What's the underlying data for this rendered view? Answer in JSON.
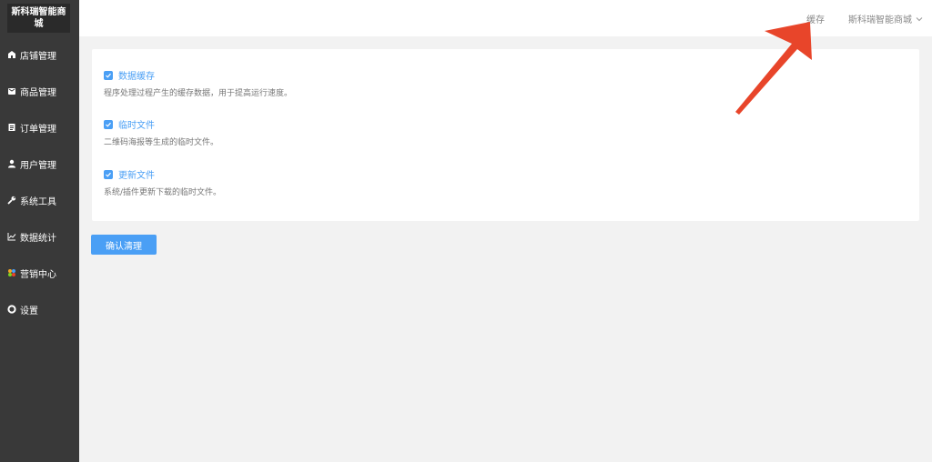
{
  "sidebar": {
    "logo": "斯科瑞智能商城",
    "items": [
      {
        "label": "店铺管理",
        "icon": "store-icon"
      },
      {
        "label": "商品管理",
        "icon": "product-icon"
      },
      {
        "label": "订单管理",
        "icon": "order-icon"
      },
      {
        "label": "用户管理",
        "icon": "user-icon"
      },
      {
        "label": "系统工具",
        "icon": "wrench-icon"
      },
      {
        "label": "数据统计",
        "icon": "chart-icon"
      },
      {
        "label": "营销中心",
        "icon": "marketing-icon"
      },
      {
        "label": "设置",
        "icon": "gear-icon"
      }
    ]
  },
  "header": {
    "cache_link": "缓存",
    "store_name": "斯科瑞智能商城"
  },
  "options": [
    {
      "label": "数据缓存",
      "desc": "程序处理过程产生的缓存数据，用于提高运行速度。",
      "checked": true
    },
    {
      "label": "临时文件",
      "desc": "二维码海报等生成的临时文件。",
      "checked": true
    },
    {
      "label": "更新文件",
      "desc": "系统/插件更新下载的临时文件。",
      "checked": true
    }
  ],
  "actions": {
    "confirm_label": "确认清理"
  },
  "colors": {
    "sidebar_bg": "#393939",
    "accent": "#4a9ff5",
    "annotation_arrow": "#e8452a"
  }
}
